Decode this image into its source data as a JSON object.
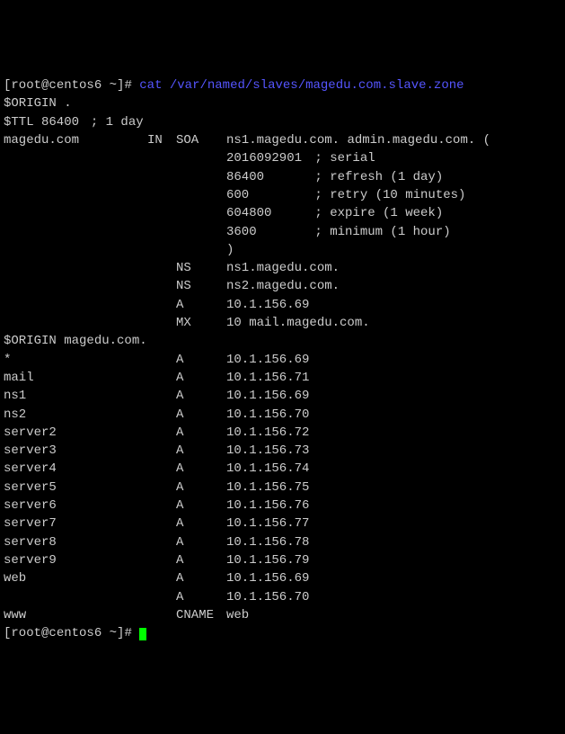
{
  "prompt_line1": {
    "open": "[",
    "userhost": "root@centos6",
    "tilde": " ~",
    "close": "]#",
    "command": "cat /var/named/slaves/magedu.com.slave.zone"
  },
  "origin_root": "$ORIGIN .",
  "ttl": {
    "label": "$TTL 86400",
    "comment": "; 1 day"
  },
  "soa": {
    "name": "magedu.com",
    "class": "IN",
    "type": "SOA",
    "mname": "ns1.magedu.com.",
    "rname": "admin.magedu.com.",
    "open": "(",
    "serial_val": "2016092901",
    "serial_c": "; serial",
    "refresh_val": "86400",
    "refresh_c": "; refresh (1 day)",
    "retry_val": "600",
    "retry_c": "; retry (10 minutes)",
    "expire_val": "604800",
    "expire_c": "; expire (1 week)",
    "minimum_val": "3600",
    "minimum_c": "; minimum (1 hour)",
    "close": ")"
  },
  "apex": [
    {
      "type": "NS",
      "value": "ns1.magedu.com."
    },
    {
      "type": "NS",
      "value": "ns2.magedu.com."
    },
    {
      "type": "A",
      "value": "10.1.156.69"
    },
    {
      "type": "MX",
      "value": "10 mail.magedu.com."
    }
  ],
  "origin_zone": "$ORIGIN magedu.com.",
  "records": [
    {
      "name": "*",
      "type": "A",
      "value": "10.1.156.69"
    },
    {
      "name": "mail",
      "type": "A",
      "value": "10.1.156.71"
    },
    {
      "name": "ns1",
      "type": "A",
      "value": "10.1.156.69"
    },
    {
      "name": "ns2",
      "type": "A",
      "value": "10.1.156.70"
    },
    {
      "name": "server2",
      "type": "A",
      "value": "10.1.156.72"
    },
    {
      "name": "server3",
      "type": "A",
      "value": "10.1.156.73"
    },
    {
      "name": "server4",
      "type": "A",
      "value": "10.1.156.74"
    },
    {
      "name": "server5",
      "type": "A",
      "value": "10.1.156.75"
    },
    {
      "name": "server6",
      "type": "A",
      "value": "10.1.156.76"
    },
    {
      "name": "server7",
      "type": "A",
      "value": "10.1.156.77"
    },
    {
      "name": "server8",
      "type": "A",
      "value": "10.1.156.78"
    },
    {
      "name": "server9",
      "type": "A",
      "value": "10.1.156.79"
    },
    {
      "name": "web",
      "type": "A",
      "value": "10.1.156.69"
    },
    {
      "name": "",
      "type": "A",
      "value": "10.1.156.70"
    },
    {
      "name": "www",
      "type": "CNAME",
      "value": "web"
    }
  ],
  "prompt_line2": {
    "open": "[",
    "userhost": "root@centos6",
    "tilde": " ~",
    "close": "]#"
  }
}
